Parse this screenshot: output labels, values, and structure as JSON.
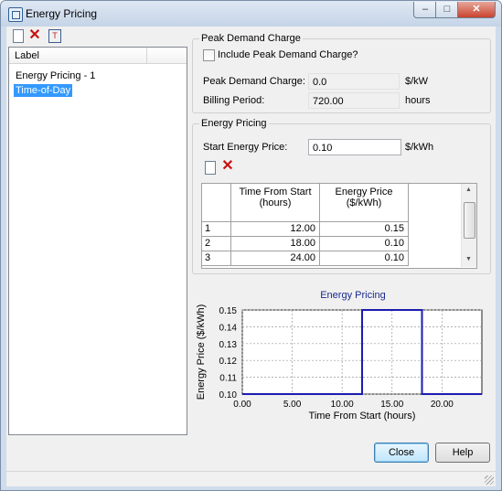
{
  "window": {
    "title": "Energy Pricing"
  },
  "list": {
    "column_header": "Label",
    "items": [
      {
        "label": "Energy Pricing - 1",
        "selected": false
      },
      {
        "label": "Time-of-Day",
        "selected": true
      }
    ]
  },
  "peak_demand": {
    "group_title": "Peak Demand Charge",
    "checkbox_label": "Include Peak Demand Charge?",
    "checked": false,
    "charge_label": "Peak Demand Charge:",
    "charge_value": "0.0",
    "charge_unit": "$/kW",
    "billing_label": "Billing Period:",
    "billing_value": "720.00",
    "billing_unit": "hours"
  },
  "energy_pricing": {
    "group_title": "Energy Pricing",
    "start_price_label": "Start Energy Price:",
    "start_price_value": "0.10",
    "start_price_unit": "$/kWh",
    "table": {
      "headers": [
        "Time From Start\n(hours)",
        "Energy Price\n($/kWh)"
      ],
      "rows": [
        {
          "index": "1",
          "time": "12.00",
          "price": "0.15"
        },
        {
          "index": "2",
          "time": "18.00",
          "price": "0.10"
        },
        {
          "index": "3",
          "time": "24.00",
          "price": "0.10"
        }
      ]
    }
  },
  "chart_data": {
    "type": "line",
    "title": "Energy Pricing",
    "xlabel": "Time From Start (hours)",
    "ylabel": "Energy Price ($/kWh)",
    "xlim": [
      0,
      24
    ],
    "ylim": [
      0.1,
      0.15
    ],
    "xticks": [
      "0.00",
      "5.00",
      "10.00",
      "15.00",
      "20.00"
    ],
    "yticks": [
      "0.10",
      "0.11",
      "0.12",
      "0.13",
      "0.14",
      "0.15"
    ],
    "grid": true,
    "series": [
      {
        "x": [
          0,
          12,
          12,
          18,
          18,
          24
        ],
        "y": [
          0.1,
          0.1,
          0.15,
          0.15,
          0.1,
          0.1
        ],
        "color": "#1c1cb0"
      }
    ]
  },
  "buttons": {
    "close": "Close",
    "help": "Help"
  },
  "colors": {
    "selection": "#3399ff",
    "chart_title": "#1a2a8c",
    "series": "#1c1cb0"
  }
}
